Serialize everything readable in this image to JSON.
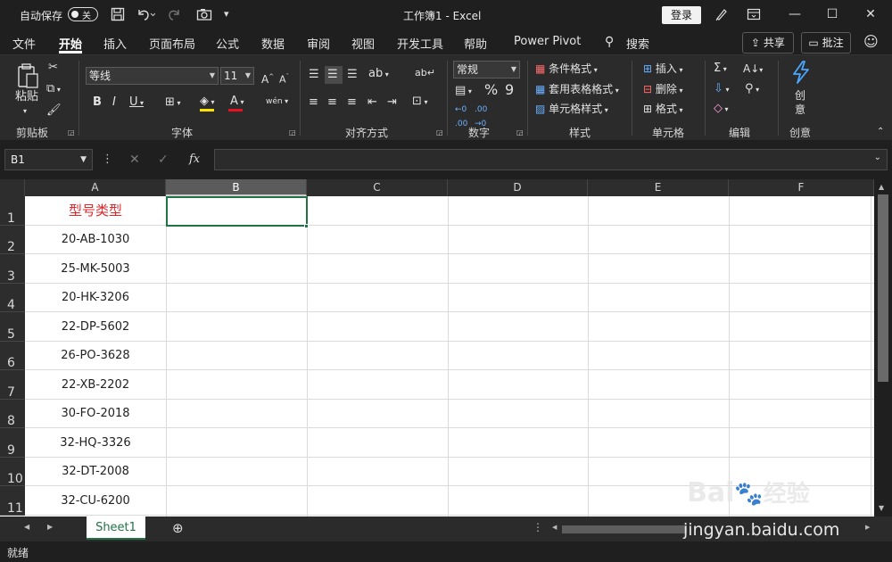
{
  "titlebar": {
    "autosave_label": "自动保存",
    "autosave_state": "关",
    "title": "工作簿1  -  Excel",
    "login": "登录"
  },
  "tabs": [
    "文件",
    "开始",
    "插入",
    "页面布局",
    "公式",
    "数据",
    "审阅",
    "视图",
    "开发工具",
    "帮助",
    "Power Pivot"
  ],
  "search_label": "搜索",
  "share_label": "共享",
  "comment_label": "批注",
  "ribbon": {
    "paste": "粘贴",
    "clipboard": "剪贴板",
    "font_name": "等线",
    "font_size": "11",
    "font_group": "字体",
    "align_group": "对齐方式",
    "number_format": "常规",
    "number_group": "数字",
    "cond_format": "条件格式",
    "table_format": "套用表格格式",
    "cell_style": "单元格样式",
    "style_group": "样式",
    "insert": "插入",
    "delete": "删除",
    "format": "格式",
    "cells_group": "单元格",
    "edit_group": "编辑",
    "create_btn_1": "创",
    "create_btn_2": "意",
    "create_group": "创意"
  },
  "formula_bar": {
    "name_box": "B1",
    "fx": "fx",
    "value": ""
  },
  "columns": [
    "A",
    "B",
    "C",
    "D",
    "E",
    "F"
  ],
  "rows": [
    {
      "num": "1",
      "a": "型号类型"
    },
    {
      "num": "2",
      "a": "20-AB-1030"
    },
    {
      "num": "3",
      "a": "25-MK-5003"
    },
    {
      "num": "4",
      "a": "20-HK-3206"
    },
    {
      "num": "5",
      "a": "22-DP-5602"
    },
    {
      "num": "6",
      "a": "26-PO-3628"
    },
    {
      "num": "7",
      "a": "22-XB-2202"
    },
    {
      "num": "8",
      "a": "30-FO-2018"
    },
    {
      "num": "9",
      "a": "32-HQ-3326"
    },
    {
      "num": "10",
      "a": "32-DT-2008"
    },
    {
      "num": "11",
      "a": "32-CU-6200"
    }
  ],
  "sheet_tab": "Sheet1",
  "status": "就绪",
  "watermark_site": "jingyan.baidu.com",
  "watermark_brand": "Bai",
  "watermark_cn": "经验",
  "colors": {
    "accent": "#217346",
    "header_text": "#e0262a",
    "dark_bg": "#1f1f1f"
  }
}
